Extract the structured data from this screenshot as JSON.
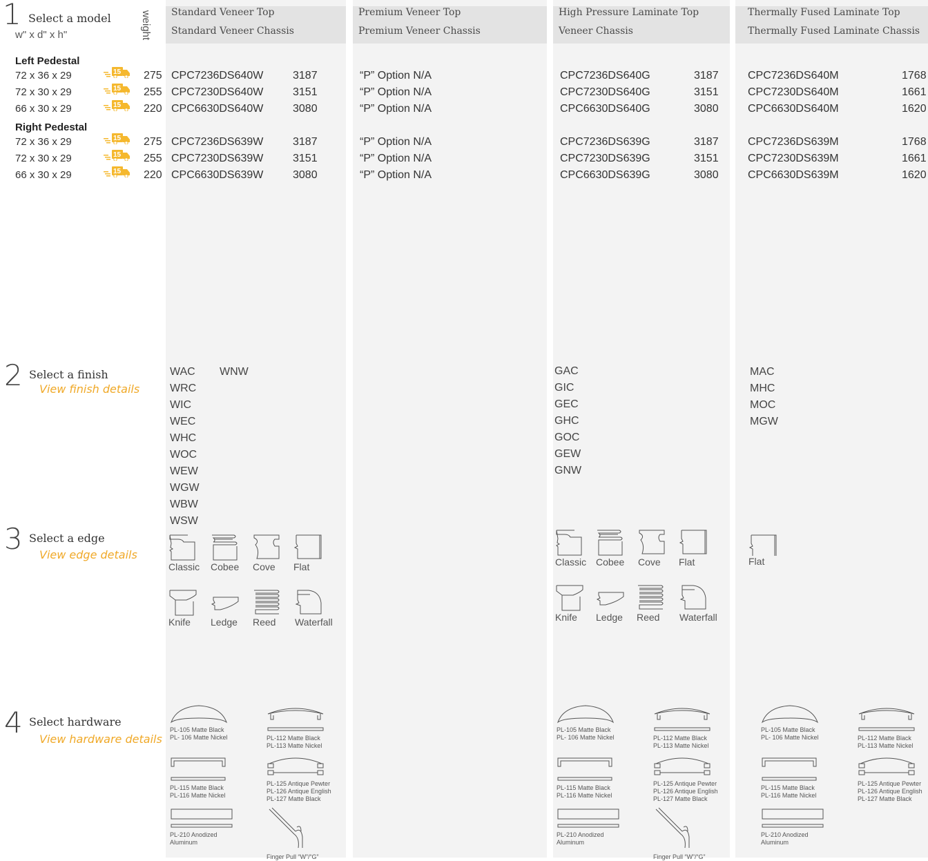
{
  "steps": {
    "s1": {
      "num": "1",
      "label": "Select a model",
      "dims": "w\" x d\" x h\"",
      "weight": "weight"
    },
    "s2": {
      "num": "2",
      "label": "Select a finish",
      "link": "View finish details"
    },
    "s3": {
      "num": "3",
      "label": "Select a edge",
      "link": "View edge details"
    },
    "s4": {
      "num": "4",
      "label": "Select hardware",
      "link": "View hardware details"
    }
  },
  "columns": [
    {
      "line1": "Standard Veneer Top",
      "line2": "Standard Veneer Chassis"
    },
    {
      "line1": "Premium Veneer Top",
      "line2": "Premium Veneer Chassis"
    },
    {
      "line1": "High Pressure Laminate Top",
      "line2": "Veneer Chassis"
    },
    {
      "line1": "Thermally Fused Laminate Top",
      "line2": "Thermally Fused Laminate Chassis"
    }
  ],
  "groups": {
    "left": "Left Pedestal",
    "right": "Right Pedestal"
  },
  "badge": "15",
  "rows": [
    {
      "size": "72 x 36 x 29",
      "weight": "275",
      "sv": "CPC7236DS640W",
      "svp": "3187",
      "pv": "“P” Option N/A",
      "hp": "CPC7236DS640G",
      "hpp": "3187",
      "tf": "CPC7236DS640M",
      "tfp": "1768"
    },
    {
      "size": "72 x 30 x 29",
      "weight": "255",
      "sv": "CPC7230DS640W",
      "svp": "3151",
      "pv": "“P” Option N/A",
      "hp": "CPC7230DS640G",
      "hpp": "3151",
      "tf": "CPC7230DS640M",
      "tfp": "1661"
    },
    {
      "size": "66 x 30 x 29",
      "weight": "220",
      "sv": "CPC6630DS640W",
      "svp": "3080",
      "pv": "“P” Option N/A",
      "hp": "CPC6630DS640G",
      "hpp": "3080",
      "tf": "CPC6630DS640M",
      "tfp": "1620"
    },
    {
      "size": "72 x 36 x 29",
      "weight": "275",
      "sv": "CPC7236DS639W",
      "svp": "3187",
      "pv": "“P” Option N/A",
      "hp": "CPC7236DS639G",
      "hpp": "3187",
      "tf": "CPC7236DS639M",
      "tfp": "1768"
    },
    {
      "size": "72 x 30 x 29",
      "weight": "255",
      "sv": "CPC7230DS639W",
      "svp": "3151",
      "pv": "“P” Option N/A",
      "hp": "CPC7230DS639G",
      "hpp": "3151",
      "tf": "CPC7230DS639M",
      "tfp": "1661"
    },
    {
      "size": "66 x 30 x 29",
      "weight": "220",
      "sv": "CPC6630DS639W",
      "svp": "3080",
      "pv": "“P” Option N/A",
      "hp": "CPC6630DS639G",
      "hpp": "3080",
      "tf": "CPC6630DS639M",
      "tfp": "1620"
    }
  ],
  "finishes": {
    "sv_a": [
      "WAC",
      "WRC",
      "WIC",
      "WEC",
      "WHC",
      "WOC",
      "WEW",
      "WGW",
      "WBW",
      "WSW"
    ],
    "sv_b": [
      "WNW"
    ],
    "hp": [
      "GAC",
      "GIC",
      "GEC",
      "GHC",
      "GOC",
      "GEW",
      "GNW"
    ],
    "tf": [
      "MAC",
      "MHC",
      "MOC",
      "MGW"
    ]
  },
  "edges": {
    "classic": "Classic",
    "cobee": "Cobee",
    "cove": "Cove",
    "flat": "Flat",
    "knife": "Knife",
    "ledge": "Ledge",
    "reed": "Reed",
    "waterfall": "Waterfall"
  },
  "hardware": {
    "h105": [
      "PL-105 Matte Black",
      "PL- 106 Matte Nickel"
    ],
    "h112": [
      "PL-112 Matte Black",
      "PL-113 Matte Nickel"
    ],
    "h115": [
      "PL-115 Matte Black",
      "PL-116 Matte Nickel"
    ],
    "h125": [
      "PL-125 Antique Pewter",
      "PL-126 Antique English",
      "PL-127 Matte Black"
    ],
    "h210": [
      "PL-210 Anodized",
      "Aluminum"
    ],
    "finger": "Finger Pull “W”/“G”"
  },
  "colors": {
    "accent": "#f0a928",
    "truck": "#f5b82e",
    "column_bg": "#f3f3f3",
    "header_bg": "#e3e3e3"
  }
}
